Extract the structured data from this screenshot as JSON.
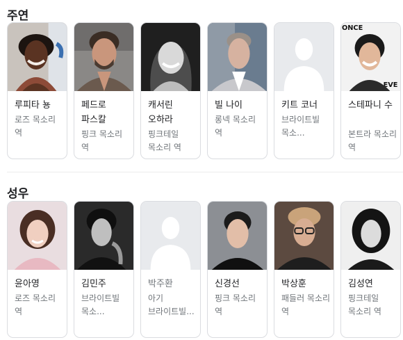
{
  "sections": [
    {
      "title": "주연",
      "cards": [
        {
          "name": "루피타 뇽",
          "role": "로즈 목소리 역"
        },
        {
          "name": "페드로 파스칼",
          "role": "핑크 목소리 역"
        },
        {
          "name": "캐서린 오하라",
          "role": "핑크테일 목소리 역"
        },
        {
          "name": "빌 나이",
          "role": "롱넥 목소리 역"
        },
        {
          "name": "키트 코너",
          "role": "브라이트빌 목소..."
        },
        {
          "name": "스테파니 수",
          "role": "본트라 목소리 역"
        }
      ]
    },
    {
      "title": "성우",
      "cards": [
        {
          "name": "윤아영",
          "role": "로즈 목소리 역"
        },
        {
          "name": "김민주",
          "role": "브라이트빌 목소..."
        },
        {
          "name": "박주환",
          "role": "아기 브라이트빌..."
        },
        {
          "name": "신경선",
          "role": "핑크 목소리 역"
        },
        {
          "name": "박상훈",
          "role": "패들러 목소리 역"
        },
        {
          "name": "김성연",
          "role": "핑크테일 목소리 역"
        }
      ]
    }
  ],
  "photo_sign_text": "ONCE",
  "photo_sign_text_2": "EVE"
}
